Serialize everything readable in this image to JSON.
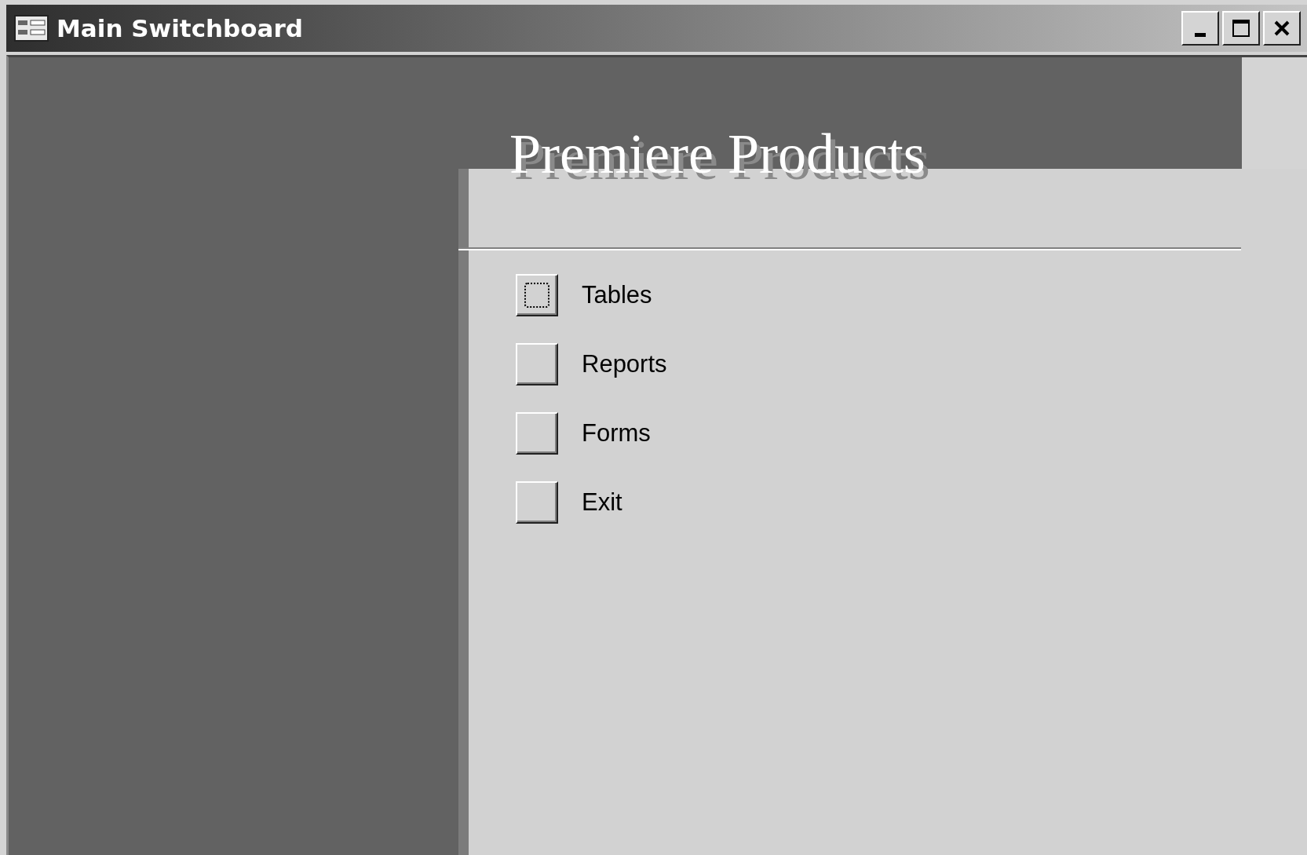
{
  "window": {
    "title": "Main Switchboard"
  },
  "heading": "Premiere Products",
  "items": [
    {
      "label": "Tables",
      "focused": true
    },
    {
      "label": "Reports",
      "focused": false
    },
    {
      "label": "Forms",
      "focused": false
    },
    {
      "label": "Exit",
      "focused": false
    }
  ]
}
